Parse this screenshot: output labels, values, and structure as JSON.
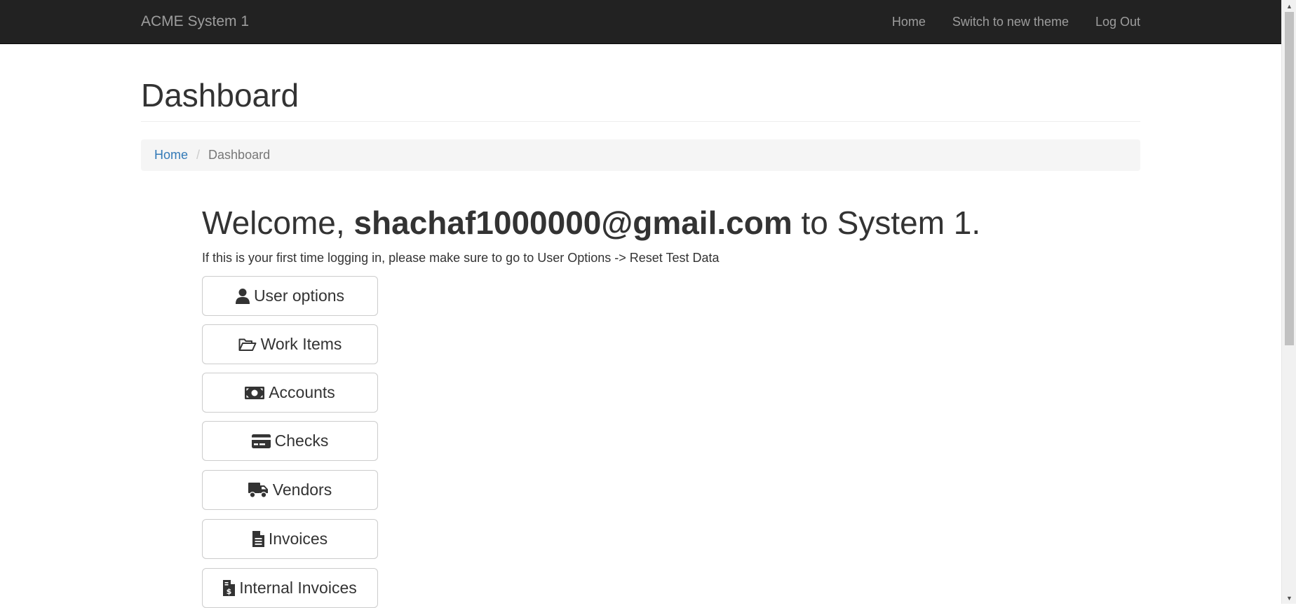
{
  "navbar": {
    "brand": "ACME System 1",
    "links": [
      {
        "label": "Home"
      },
      {
        "label": "Switch to new theme"
      },
      {
        "label": "Log Out"
      }
    ]
  },
  "page": {
    "title": "Dashboard"
  },
  "breadcrumb": {
    "home": "Home",
    "separator": "/",
    "current": "Dashboard"
  },
  "welcome": {
    "prefix": "Welcome, ",
    "email": "shachaf1000000@gmail.com",
    "suffix": " to System 1.",
    "hint": "If this is your first time logging in, please make sure to go to User Options -> Reset Test Data"
  },
  "menu": [
    {
      "label": "User options",
      "icon": "user-icon"
    },
    {
      "label": "Work Items",
      "icon": "folder-open-icon"
    },
    {
      "label": "Accounts",
      "icon": "money-bill-icon"
    },
    {
      "label": "Checks",
      "icon": "credit-card-icon"
    },
    {
      "label": "Vendors",
      "icon": "truck-icon"
    },
    {
      "label": "Invoices",
      "icon": "file-alt-icon"
    },
    {
      "label": "Internal Invoices",
      "icon": "file-invoice-dollar-icon"
    }
  ],
  "colors": {
    "navbar_bg": "#222222",
    "navbar_text": "#9d9d9d",
    "link": "#337ab7",
    "breadcrumb_bg": "#f5f5f5",
    "text": "#333333"
  }
}
